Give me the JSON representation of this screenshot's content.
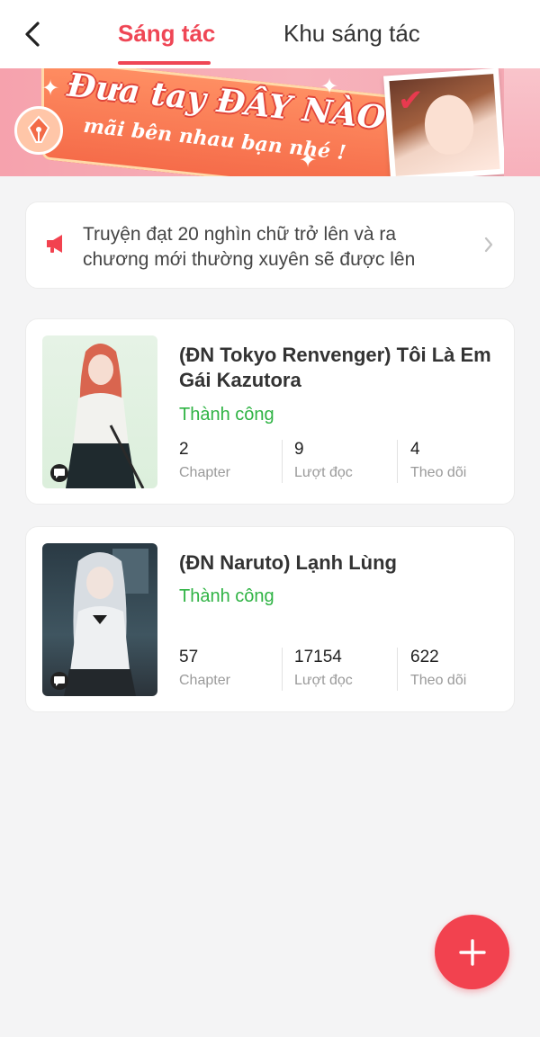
{
  "header": {
    "tabs": [
      {
        "label": "Sáng tác",
        "active": true
      },
      {
        "label": "Khu sáng tác",
        "active": false
      }
    ]
  },
  "banner": {
    "title": "Đưa tay ĐÂY NÀO",
    "subtitle": "mãi bên nhau bạn nhé !"
  },
  "notice": {
    "text": "Truyện đạt 20 nghìn chữ trở lên và ra chương mới thường xuyên sẽ được lên"
  },
  "stories": [
    {
      "title": "(ĐN Tokyo Renvenger) Tôi Là Em Gái Kazutora",
      "status": "Thành công",
      "stats": [
        {
          "value": "2",
          "label": "Chapter"
        },
        {
          "value": "9",
          "label": "Lượt đọc"
        },
        {
          "value": "4",
          "label": "Theo dõi"
        }
      ]
    },
    {
      "title": "(ĐN Naruto) Lạnh Lùng",
      "status": "Thành công",
      "stats": [
        {
          "value": "57",
          "label": "Chapter"
        },
        {
          "value": "17154",
          "label": "Lượt đọc"
        },
        {
          "value": "622",
          "label": "Theo dõi"
        }
      ]
    }
  ],
  "icons": {
    "back": "chevron-left-icon",
    "notice": "megaphone-icon",
    "chevron": "chevron-right-icon",
    "comment": "comment-bubble-icon",
    "fab": "plus-icon"
  },
  "colors": {
    "accent": "#ef4655",
    "success": "#2fb344",
    "fab": "#f2424f"
  }
}
